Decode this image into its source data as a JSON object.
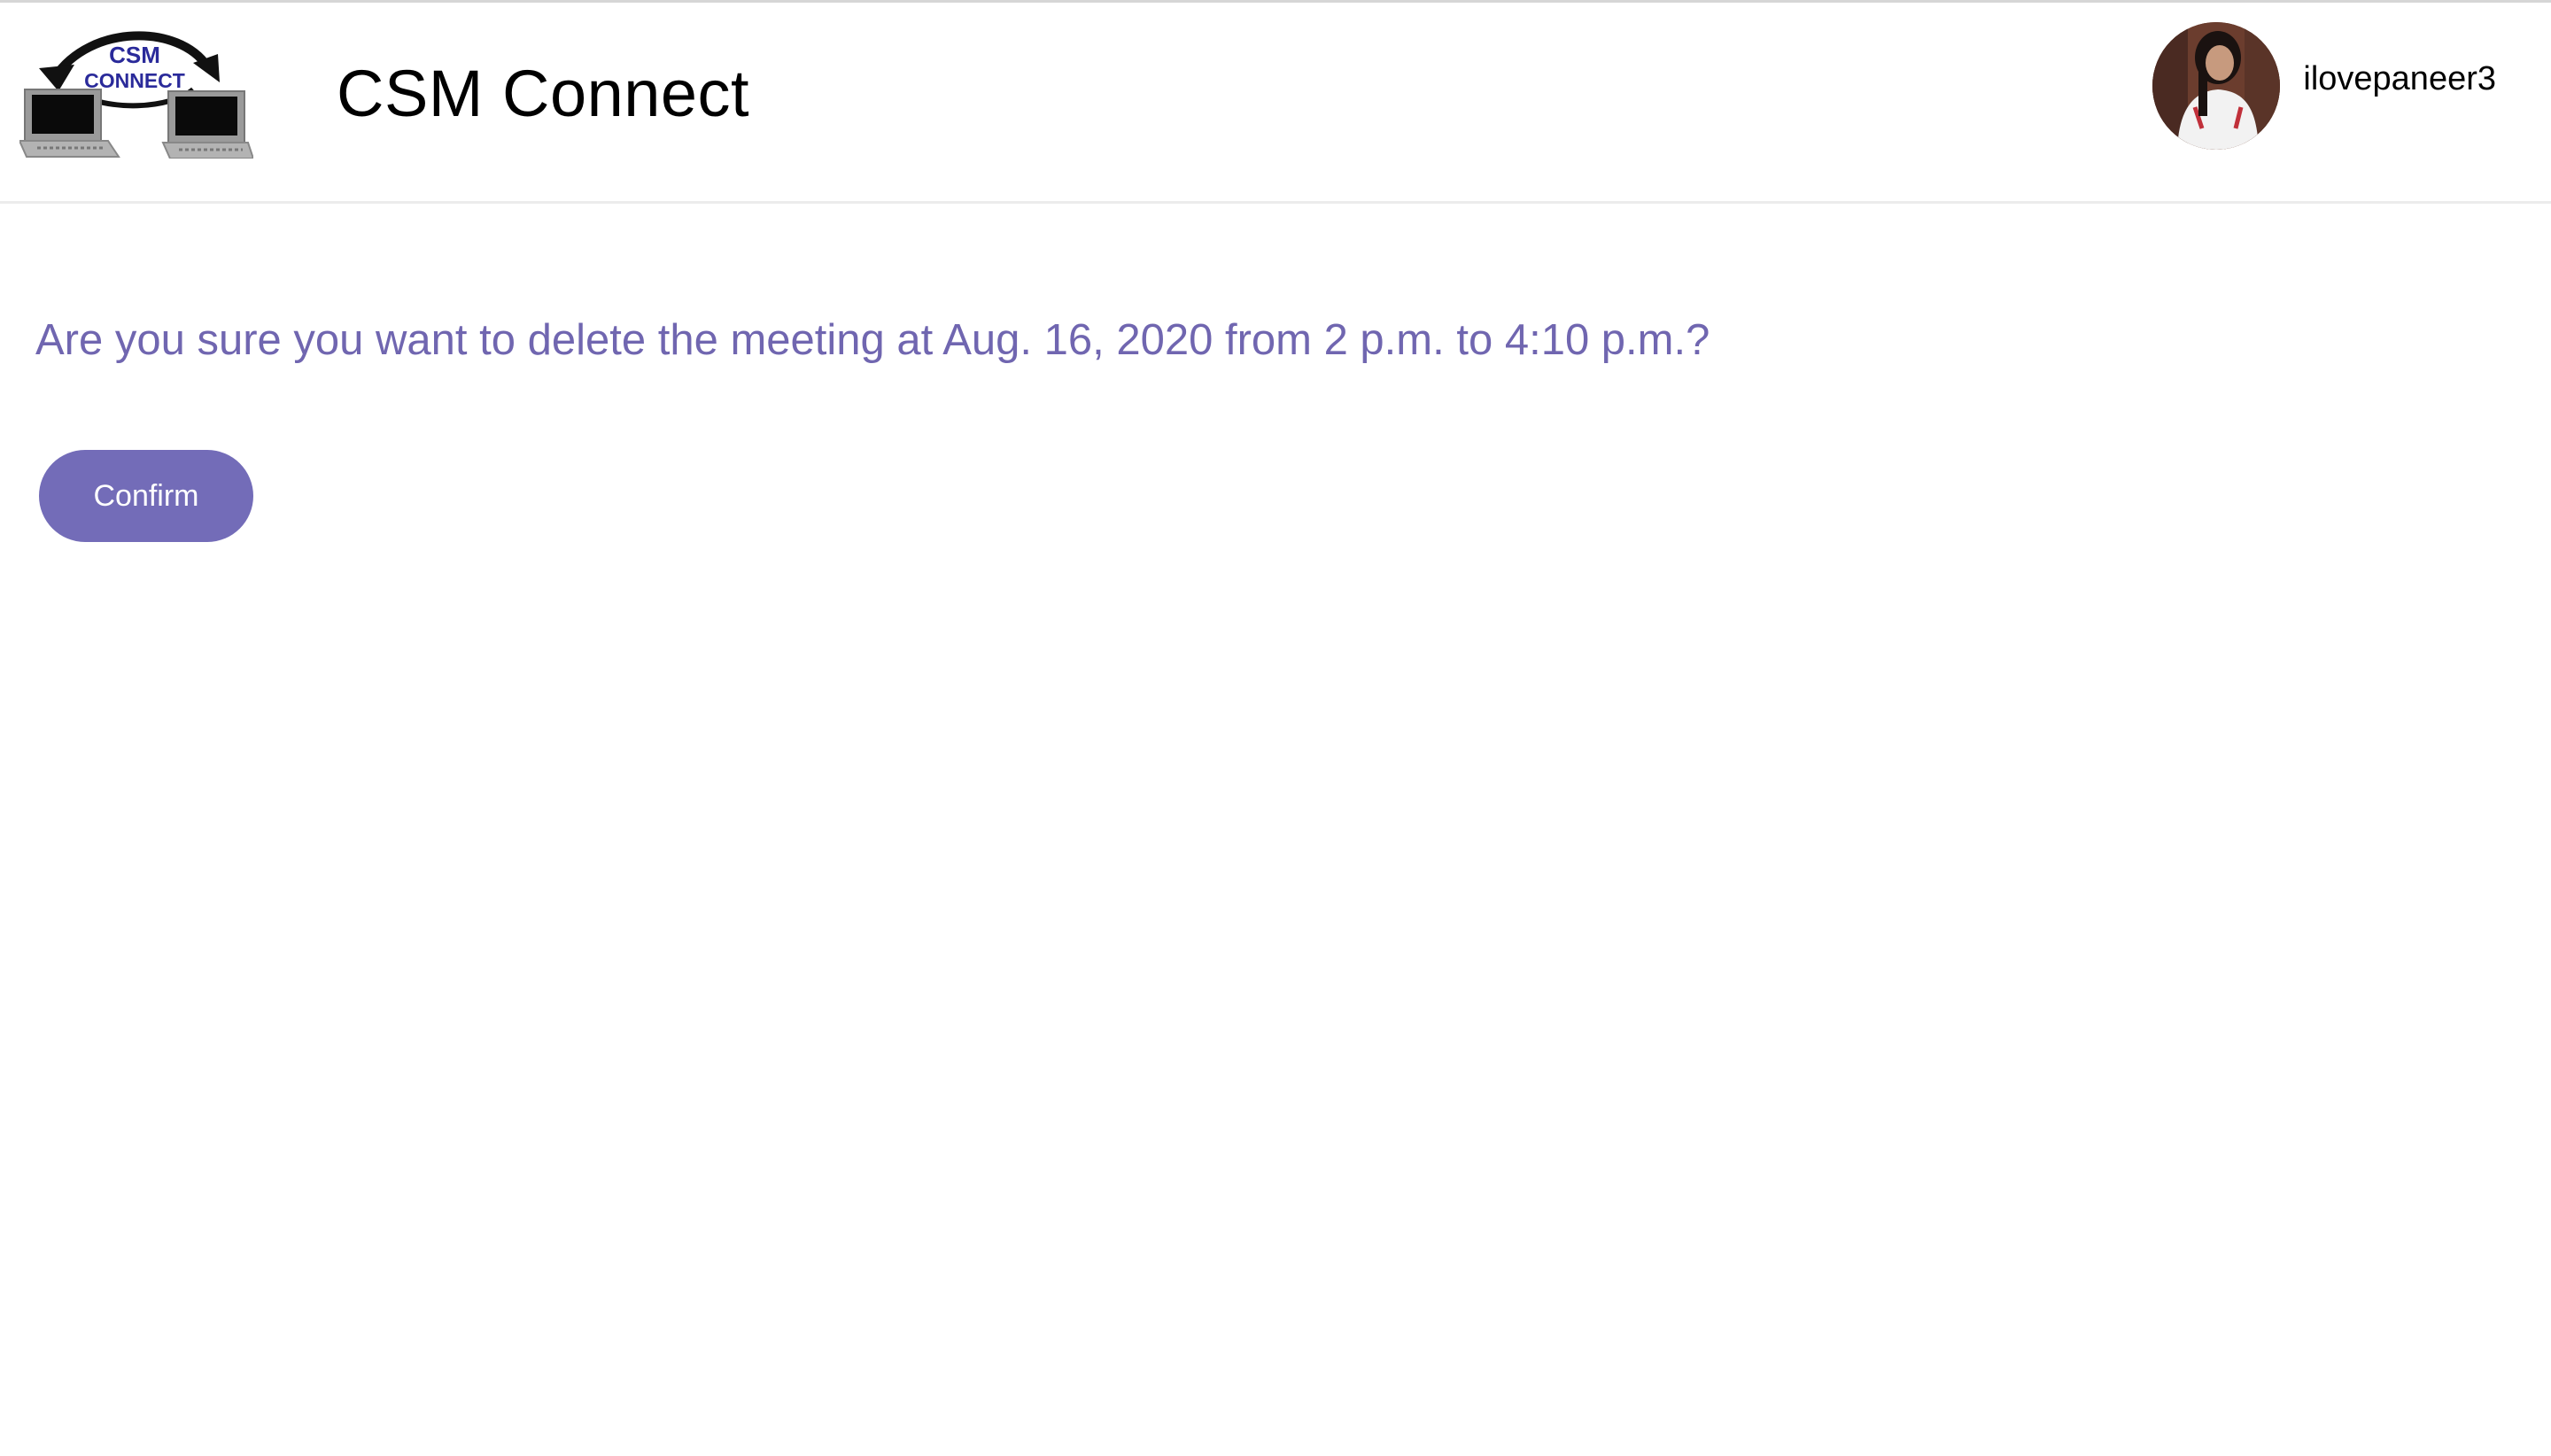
{
  "header": {
    "brand_title": "CSM Connect",
    "logo_text_line1": "CSM",
    "logo_text_line2": "CONNECT",
    "username": "ilovepaneer3"
  },
  "main": {
    "prompt": "Are you sure you want to delete the meeting at Aug. 16, 2020 from 2 p.m. to 4:10 p.m.?",
    "confirm_label": "Confirm"
  },
  "colors": {
    "accent": "#736cb8",
    "prompt_text": "#7066b0"
  },
  "icons": {
    "logo": "csm-connect-logo",
    "avatar": "user-avatar"
  }
}
